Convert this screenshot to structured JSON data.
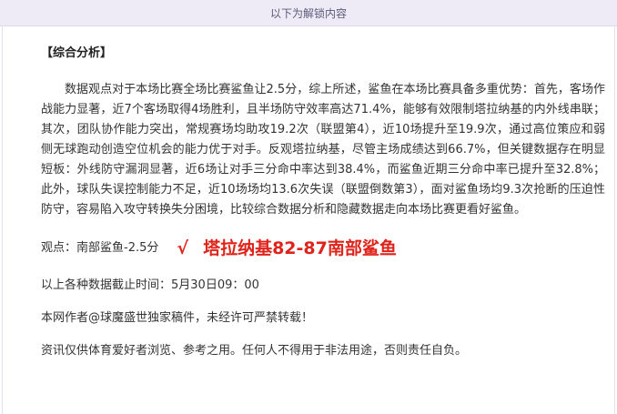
{
  "banner": {
    "text": "以下为解锁内容"
  },
  "article": {
    "section_title": "【综合分析】",
    "analysis": "数据观点对于本场比赛全场比赛鲨鱼让2.5分，综上所述，鲨鱼在本场比赛具备多重优势：首先，客场作战能力显著，近7个客场取得4场胜利，且半场防守效率高达71.4%，能够有效限制塔拉纳基的内外线串联；其次，团队协作能力突出，常规赛场均助攻19.2次（联盟第4），近10场提升至19.9次，通过高位策应和弱侧无球跑动创造空位机会的能力优于对手。反观塔拉纳基，尽管主场成绩达到66.7%，但关键数据存在明显短板：外线防守漏洞显著，近6场让对手三分命中率达到38.4%，而鲨鱼近期三分命中率已提升至32.8%；此外，球队失误控制能力不足，近10场场均13.6次失误（联盟倒数第3），面对鲨鱼场均9.3次抢断的压迫性防守，容易陷入攻守转换失分困境，比较综合数据分析和隐藏数据走向本场比赛更看好鲨鱼。",
    "verdict_label": "观点：南部鲨鱼-2.5分",
    "check_mark": "√",
    "final_score": "塔拉纳基82-87南部鲨鱼",
    "data_cutoff": "以上各种数据截止时间：5月30日09：00",
    "copyright": "本网作者@球魔盛世独家稿件，未经许可严禁转载！",
    "disclaimer": "资讯仅供体育爱好者浏览、参考之用。任何人不得用于非法用途，否则责任自负。"
  },
  "colors": {
    "banner_bg": "#eeebf7",
    "highlight_red": "#e0231a",
    "body_text": "#333333"
  }
}
